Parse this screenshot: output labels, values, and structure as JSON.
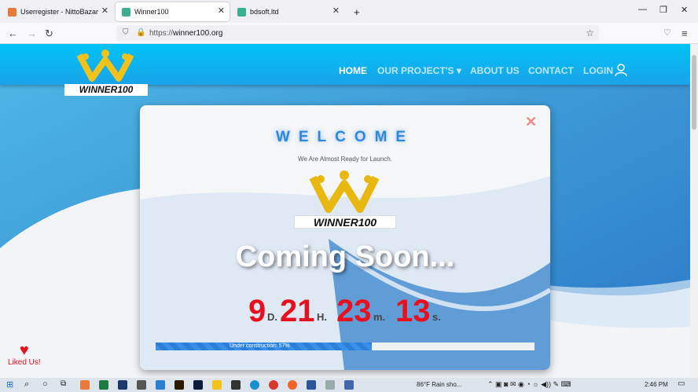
{
  "browser": {
    "tabs": [
      {
        "label": "Userregister - NittoBazar",
        "active": false
      },
      {
        "label": "Winner100",
        "active": true
      },
      {
        "label": "bdsoft.ltd",
        "active": false
      }
    ],
    "new_tab_label": "+",
    "url_scheme": "https://",
    "url_domain": "winner100.org"
  },
  "site": {
    "logo_text": "WINNER100",
    "menu": [
      {
        "label": "HOME"
      },
      {
        "label": "OUR PROJECT'S ▾"
      },
      {
        "label": "ABOUT US"
      },
      {
        "label": "CONTACT"
      },
      {
        "label": "LOGIN"
      }
    ]
  },
  "modal": {
    "title": "WELCOME",
    "subtitle": "We Are Almost Ready for Launch.",
    "logo_text": "WINNER100",
    "headline": "Coming Soon...",
    "countdown": [
      {
        "value": "9",
        "unit": "D."
      },
      {
        "value": "21",
        "unit": "H."
      },
      {
        "value": "23",
        "unit": "m."
      },
      {
        "value": "13",
        "unit": "s."
      }
    ],
    "progress_label": "Under construction: 57%",
    "progress_percent": 57
  },
  "liked": {
    "label": "Liked Us!"
  },
  "taskbar": {
    "weather": "86°F  Rain sho...",
    "time": "2:46 PM"
  },
  "colors": {
    "header": "#1aa3ea",
    "countdown": "#e8101f",
    "accent": "#2e86de"
  }
}
